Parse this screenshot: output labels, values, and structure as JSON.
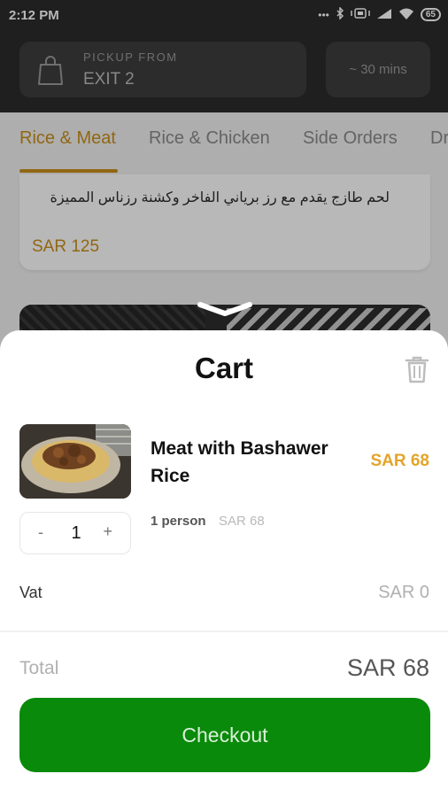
{
  "status_bar": {
    "time": "2:12 PM",
    "battery": "65"
  },
  "header": {
    "pickup_label": "PICKUP FROM",
    "pickup_value": "EXIT 2",
    "time_estimate": "~ 30 mins"
  },
  "tabs": [
    "Rice & Meat",
    "Rice & Chicken",
    "Side Orders",
    "Dr"
  ],
  "active_tab": 0,
  "menu_card": {
    "description": "لحم طازج يقدم مع رز برياني الفاخر وكشنة رزناس المميزة",
    "price": "SAR 125"
  },
  "cart": {
    "title": "Cart",
    "item": {
      "name": "Meat with Bashawer Rice",
      "price": "SAR 68",
      "quantity": "1",
      "minus": "-",
      "plus": "+",
      "variant_label": "1 person",
      "variant_price": "SAR 68"
    },
    "vat_label": "Vat",
    "vat_value": "SAR 0",
    "total_label": "Total",
    "total_value": "SAR 68",
    "checkout_label": "Checkout"
  },
  "colors": {
    "accent": "#c98f19",
    "price_orange": "#e3a52a",
    "checkout_green": "#0a8a0a",
    "header_dark": "#2b2b2b"
  },
  "icons": [
    "shopping-bag-icon",
    "trash-icon",
    "chevron-down-icon",
    "wifi-icon",
    "signal-icon",
    "bluetooth-icon"
  ]
}
